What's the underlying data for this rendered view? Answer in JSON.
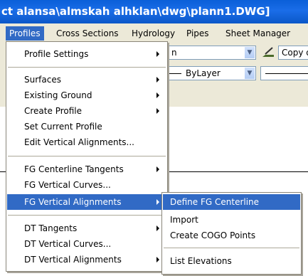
{
  "window": {
    "title": "ct alansa\\almskah alhklan\\dwg\\plann1.DWG]"
  },
  "menubar": {
    "items": [
      "Profiles",
      "Cross Sections",
      "Hydrology",
      "Pipes",
      "Sheet Manager"
    ]
  },
  "toolbar": {
    "combo1_value": "n",
    "plot_style_value": "Copy of S",
    "linetype_value": "ByLayer"
  },
  "profiles_menu": {
    "groups": [
      [
        {
          "label": "Profile Settings",
          "submenu": true
        }
      ],
      [
        {
          "label": "Surfaces",
          "submenu": true
        },
        {
          "label": "Existing Ground",
          "submenu": true
        },
        {
          "label": "Create Profile",
          "submenu": true
        },
        {
          "label": "Set Current Profile",
          "submenu": false
        },
        {
          "label": "Edit Vertical Alignments...",
          "submenu": false
        }
      ],
      [
        {
          "label": "FG Centerline Tangents",
          "submenu": true
        },
        {
          "label": "FG Vertical Curves...",
          "submenu": false
        },
        {
          "label": "FG Vertical Alignments",
          "submenu": true,
          "highlighted": true
        }
      ],
      [
        {
          "label": "DT Tangents",
          "submenu": true
        },
        {
          "label": "DT Vertical Curves...",
          "submenu": false
        },
        {
          "label": "DT Vertical Alignments",
          "submenu": true
        }
      ]
    ]
  },
  "fg_vertical_submenu": {
    "items": [
      {
        "label": "Define FG Centerline",
        "highlighted": true
      },
      {
        "label": "Import"
      },
      {
        "label": "Create COGO Points"
      },
      {
        "label": "List Elevations"
      }
    ]
  }
}
